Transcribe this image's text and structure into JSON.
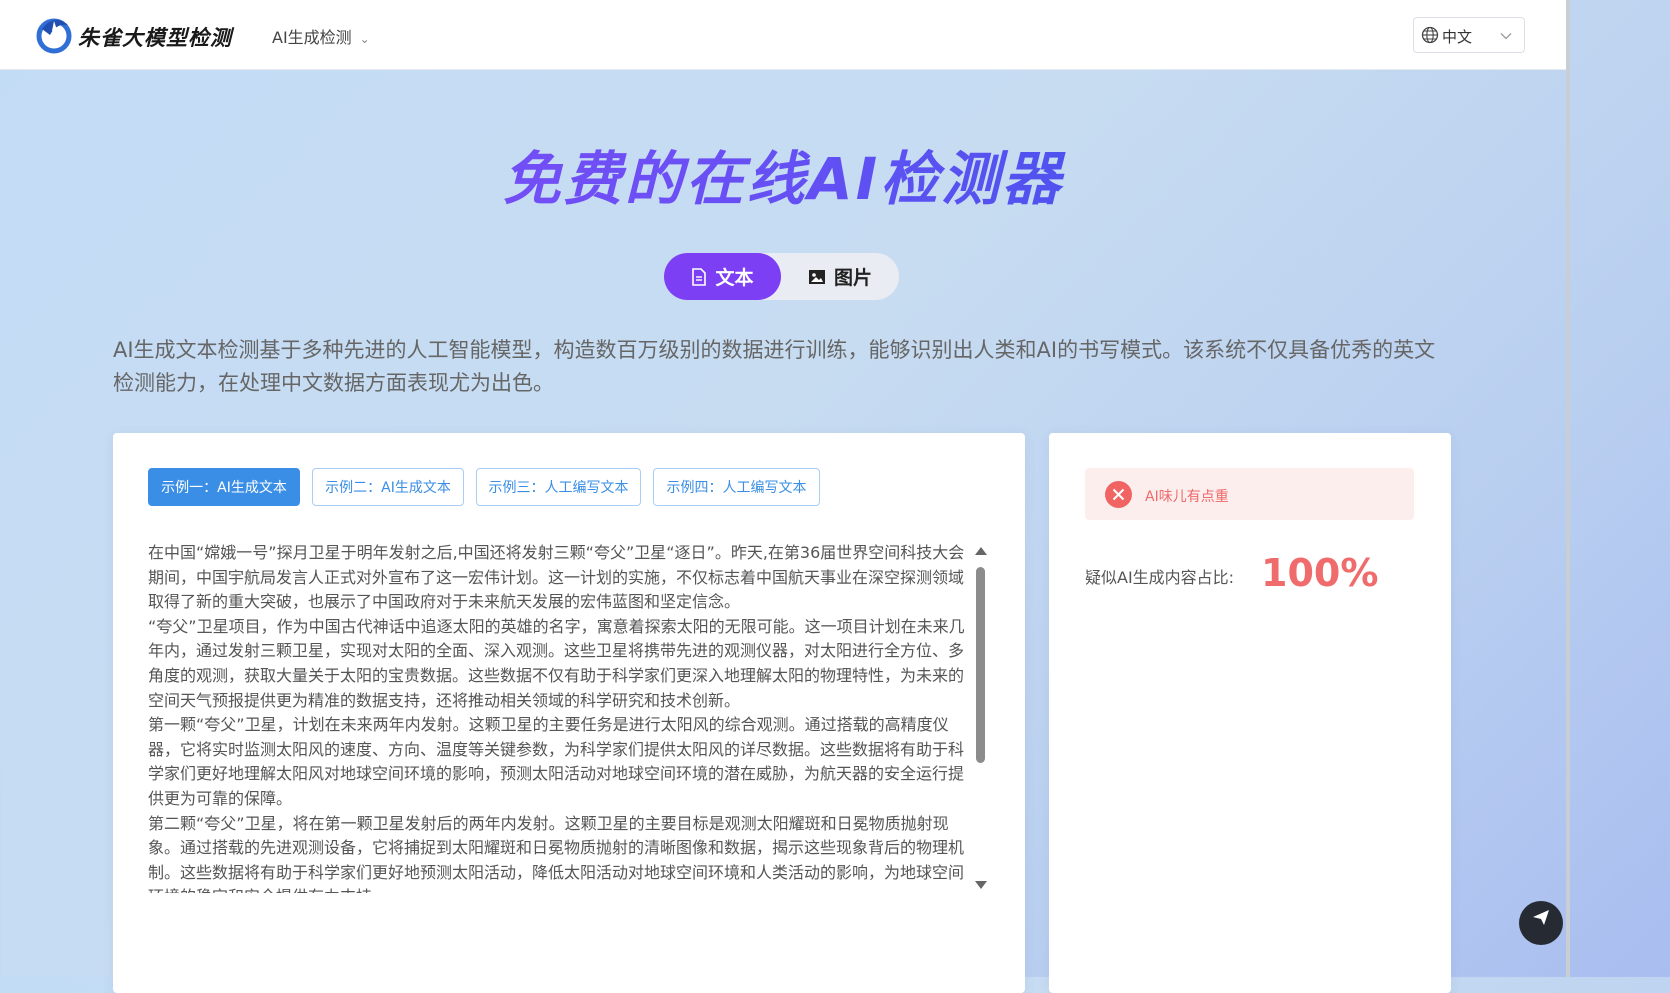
{
  "header": {
    "brand": "朱雀大模型检测",
    "nav_menu": "AI生成检测",
    "language": "中文"
  },
  "hero": {
    "title": "免费的在线AI检测器"
  },
  "mode_tabs": [
    {
      "label": "文本",
      "icon": "document-icon",
      "active": true
    },
    {
      "label": "图片",
      "icon": "image-icon",
      "active": false
    }
  ],
  "description": "AI生成文本检测基于多种先进的人工智能模型，构造数百万级别的数据进行训练，能够识别出人类和AI的书写模式。该系统不仅具备优秀的英文检测能力，在处理中文数据方面表现尤为出色。",
  "examples": [
    {
      "label": "示例一：AI生成文本",
      "active": true
    },
    {
      "label": "示例二：AI生成文本",
      "active": false
    },
    {
      "label": "示例三：人工编写文本",
      "active": false
    },
    {
      "label": "示例四：人工编写文本",
      "active": false
    }
  ],
  "sample_text": {
    "paragraphs": [
      "在中国“嫦娥一号”探月卫星于明年发射之后,中国还将发射三颗“夸父”卫星“逐日”。昨天,在第36届世界空间科技大会期间，中国宇航局发言人正式对外宣布了这一宏伟计划。这一计划的实施，不仅标志着中国航天事业在深空探测领域取得了新的重大突破，也展示了中国政府对于未来航天发展的宏伟蓝图和坚定信念。",
      "“夸父”卫星项目，作为中国古代神话中追逐太阳的英雄的名字，寓意着探索太阳的无限可能。这一项目计划在未来几年内，通过发射三颗卫星，实现对太阳的全面、深入观测。这些卫星将携带先进的观测仪器，对太阳进行全方位、多角度的观测，获取大量关于太阳的宝贵数据。这些数据不仅有助于科学家们更深入地理解太阳的物理特性，为未来的空间天气预报提供更为精准的数据支持，还将推动相关领域的科学研究和技术创新。",
      "第一颗“夸父”卫星，计划在未来两年内发射。这颗卫星的主要任务是进行太阳风的综合观测。通过搭载的高精度仪器，它将实时监测太阳风的速度、方向、温度等关键参数，为科学家们提供太阳风的详尽数据。这些数据将有助于科学家们更好地理解太阳风对地球空间环境的影响，预测太阳活动对地球空间环境的潜在威胁，为航天器的安全运行提供更为可靠的保障。",
      "第二颗“夸父”卫星，将在第一颗卫星发射后的两年内发射。这颗卫星的主要目标是观测太阳耀斑和日冕物质抛射现象。通过搭载的先进观测设备，它将捕捉到太阳耀斑和日冕物质抛射的清晰图像和数据，揭示这些现象背后的物理机制。这些数据将有助于科学家们更好地预测太阳活动，降低太阳活动对地球空间环境和人类活动的影响，为地球空间环境的稳定和安全提供有力支持。"
    ]
  },
  "result": {
    "alert": "AI味儿有点重",
    "ratio_label": "疑似AI生成内容占比:",
    "ratio_value": "100%"
  },
  "colors": {
    "accent_purple": "#7c3ff3",
    "example_blue": "#3a8ee6",
    "alert_red": "#f06464"
  }
}
